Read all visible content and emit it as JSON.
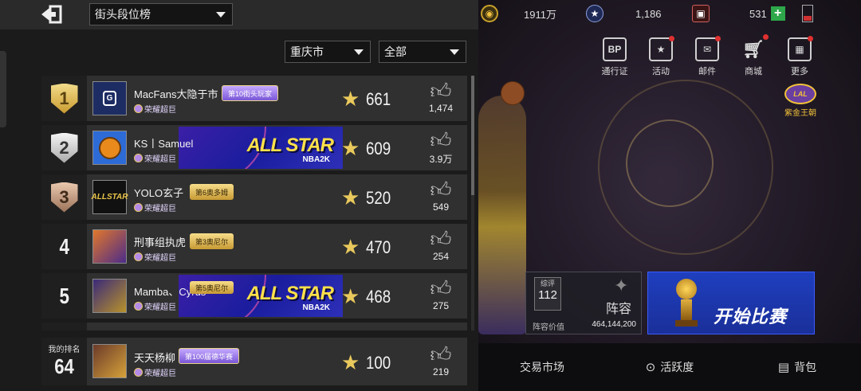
{
  "header": {
    "board_select": "街头段位榜",
    "region_select": "重庆市",
    "filter_select": "全部"
  },
  "rows": [
    {
      "rank": "1",
      "name": "MacFans大隐于市",
      "title": "荣耀超巨",
      "badge": "第10街头玩家",
      "score": "661",
      "likes": "1,474"
    },
    {
      "rank": "2",
      "name": "KS丨Samuel",
      "title": "荣耀超巨",
      "banner": "ALL STAR",
      "banner_sub": "NBA2K",
      "score": "609",
      "likes": "3.9万"
    },
    {
      "rank": "3",
      "name": "YOLO玄子",
      "title": "荣耀超巨",
      "badge": "第6奥多姆",
      "score": "520",
      "likes": "549"
    },
    {
      "rank": "4",
      "name": "刑事组执虎",
      "title": "荣耀超巨",
      "badge": "第3奥尼尔",
      "score": "470",
      "likes": "254"
    },
    {
      "rank": "5",
      "name": "Mamba、Cyrus",
      "title": "荣耀超巨",
      "badge": "第5奥尼尔",
      "banner": "ALL STAR",
      "banner_sub": "NBA2K",
      "score": "468",
      "likes": "275"
    }
  ],
  "my_rank": {
    "label": "我的排名",
    "rank": "64",
    "name": "天天杨柳",
    "title": "荣耀超巨",
    "badge": "第100届德华赛",
    "score": "100",
    "likes": "219"
  },
  "topbar": {
    "coins": "1911万",
    "mid_value": "1,186",
    "gems": "531"
  },
  "menu": {
    "pass": "通行证",
    "pass_icon_text": "BP",
    "events": "活动",
    "mail": "邮件",
    "shop": "商城",
    "more": "更多",
    "lakers_label": "紫金王朝"
  },
  "lineup": {
    "rating_label": "综评",
    "rating": "112",
    "title": "阵容",
    "value_label": "阵容价值",
    "value": "464,144,200"
  },
  "start_button": "开始比赛",
  "bottom_tabs": {
    "market": "交易市场",
    "activity": "活跃度",
    "bag": "背包"
  }
}
